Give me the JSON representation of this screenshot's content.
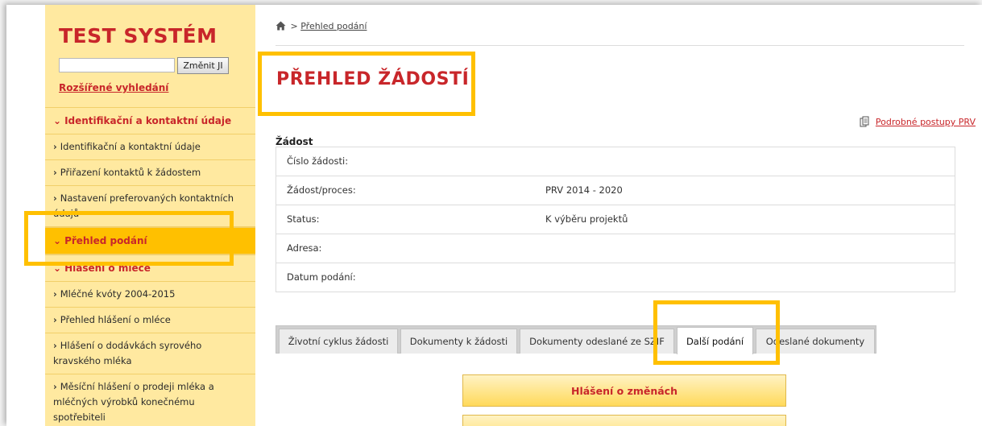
{
  "sidebar": {
    "app_title": "TEST SYSTÉM",
    "search": {
      "value": "",
      "placeholder": ""
    },
    "change_button": "Změnit JI",
    "advanced_search": "Rozšířené vyhledání",
    "sections": [
      {
        "label": "Identifikační a kontaktní údaje",
        "items": [
          "Identifikační a kontaktní údaje",
          "Přiřazení kontaktů k žádostem",
          "Nastavení preferovaných kontaktních údajů"
        ]
      },
      {
        "label": "Přehled podání",
        "items": []
      },
      {
        "label": "Hlášení o mléce",
        "items": [
          "Mléčné kvóty 2004-2015",
          "Přehled hlášení o mléce",
          "Hlášení o dodávkách syrového kravského mléka",
          "Měsíční hlášení o prodeji mléka a mléčných výrobků konečnému spotřebiteli"
        ]
      }
    ]
  },
  "breadcrumb": {
    "separator": ">",
    "current": "Přehled podání"
  },
  "page_title": "PŘEHLED ŽÁDOSTÍ",
  "prv_link": "Podrobné postupy PRV",
  "request": {
    "heading": "Žádost",
    "rows": [
      {
        "label": "Číslo žádosti:",
        "value": ""
      },
      {
        "label": "Žádost/proces:",
        "value": "PRV 2014 - 2020"
      },
      {
        "label": "Status:",
        "value": "K výběru projektů"
      },
      {
        "label": "Adresa:",
        "value": ""
      },
      {
        "label": "Datum podání:",
        "value": ""
      }
    ]
  },
  "tabs": [
    "Životní cyklus žádosti",
    "Dokumenty k žádosti",
    "Dokumenty odeslané ze SZIF",
    "Další podání",
    "Odeslané dokumenty"
  ],
  "active_tab": "Další podání",
  "actions": {
    "changes_button": "Hlášení o změnách",
    "second_button": ""
  },
  "colors": {
    "accent_red": "#c8262a",
    "sidebar_bg": "#ffe9a0",
    "highlight_yellow": "#ffc000"
  }
}
